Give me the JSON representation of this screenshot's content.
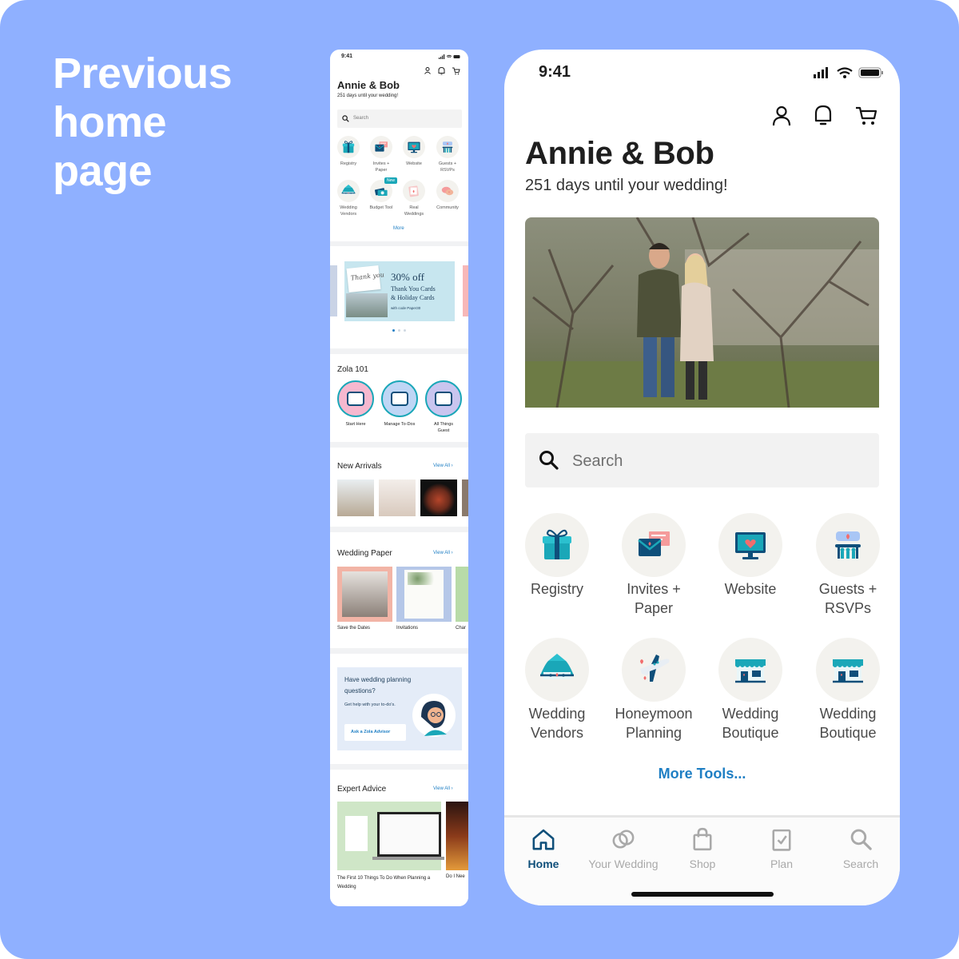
{
  "heading": {
    "line1": "Previous",
    "line2": "home",
    "line3": "page"
  },
  "old_page": {
    "status_time": "9:41",
    "couple": "Annie & Bob",
    "countdown": "251 days until your wedding!",
    "search_placeholder": "Search",
    "tools": [
      {
        "label": "Registry",
        "icon": "gift-icon"
      },
      {
        "label": "Invites +\nPaper",
        "icon": "envelope-icon"
      },
      {
        "label": "Website",
        "icon": "monitor-icon"
      },
      {
        "label": "Guests +\nRSVPs",
        "icon": "guests-icon"
      },
      {
        "label": "Wedding\nVendors",
        "icon": "tent-icon"
      },
      {
        "label": "Budget Tool",
        "icon": "money-icon",
        "badge": "New"
      },
      {
        "label": "Real\nWeddings",
        "icon": "photo-icon"
      },
      {
        "label": "Community",
        "icon": "chat-icon"
      }
    ],
    "more_link": "More",
    "promo": {
      "offer": "30% off",
      "line1": "Thank You Cards",
      "line2": "& Holiday Cards",
      "code": "with code Paper30",
      "card_script": "Thank you"
    },
    "zola101": {
      "title": "Zola 101",
      "items": [
        "Start Here",
        "Manage To-Dos",
        "All Things\nGuest"
      ]
    },
    "new_arrivals": {
      "title": "New Arrivals",
      "view_all": "View All"
    },
    "wedding_paper": {
      "title": "Wedding Paper",
      "view_all": "View All",
      "items": [
        "Save the Dates",
        "Invitations",
        "Char"
      ]
    },
    "advisor": {
      "title": "Have wedding planning questions?",
      "subtitle": "Get help with your to-do's.",
      "button": "Ask a Zola Advisor"
    },
    "expert_advice": {
      "title": "Expert Advice",
      "view_all": "View All",
      "article1": "The First 10 Things To Do When Planning a Wedding",
      "article2": "Do I Nee"
    }
  },
  "new_page": {
    "status_time": "9:41",
    "couple": "Annie & Bob",
    "countdown": "251 days until your wedding!",
    "search_placeholder": "Search",
    "tools": [
      {
        "label": "Registry",
        "icon": "gift-icon"
      },
      {
        "label": "Invites +\nPaper",
        "icon": "envelope-icon"
      },
      {
        "label": "Website",
        "icon": "monitor-icon"
      },
      {
        "label": "Guests +\nRSVPs",
        "icon": "guests-icon"
      },
      {
        "label": "Wedding\nVendors",
        "icon": "tent-icon"
      },
      {
        "label": "Honeymoon\nPlanning",
        "icon": "airplane-icon"
      },
      {
        "label": "Wedding\nBoutique",
        "icon": "storefront-icon"
      },
      {
        "label": "Wedding\nBoutique",
        "icon": "storefront-icon"
      }
    ],
    "more_tools": "More Tools...",
    "tabs": [
      {
        "label": "Home",
        "icon": "home-icon",
        "active": true
      },
      {
        "label": "Your Wedding",
        "icon": "rings-icon",
        "active": false
      },
      {
        "label": "Shop",
        "icon": "bag-icon",
        "active": false
      },
      {
        "label": "Plan",
        "icon": "checklist-icon",
        "active": false
      },
      {
        "label": "Search",
        "icon": "search-icon",
        "active": false
      }
    ]
  },
  "colors": {
    "background": "#8fb0ff",
    "teal": "#1aa7b8",
    "navy": "#0f4f7a",
    "link": "#1f7fc4",
    "coral": "#f26d6d"
  }
}
